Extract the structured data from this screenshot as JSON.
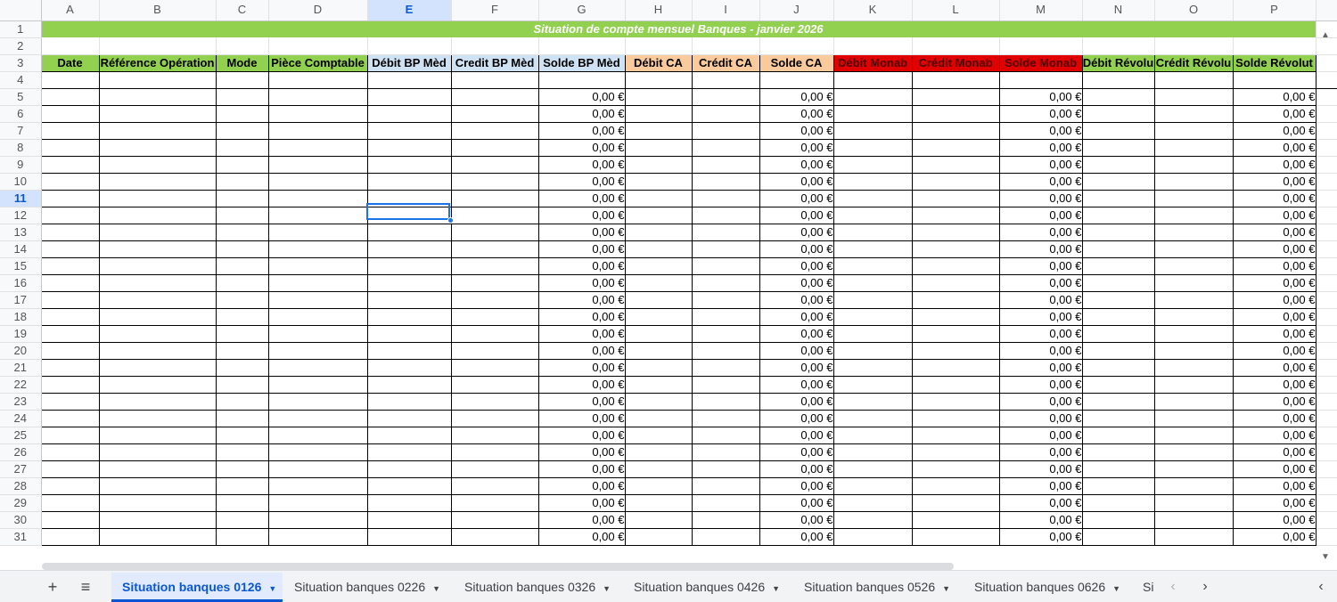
{
  "columns": [
    "A",
    "B",
    "C",
    "D",
    "E",
    "F",
    "G",
    "H",
    "I",
    "J",
    "K",
    "L",
    "M",
    "N",
    "O",
    "P"
  ],
  "selected_column": "E",
  "selected_row": 11,
  "title": "Situation de compte mensuel Banques - janvier 2026",
  "headers": [
    {
      "label": "Date",
      "bg": "#92d050",
      "color": "#000000"
    },
    {
      "label": "Référence Opération",
      "bg": "#92d050",
      "color": "#000000"
    },
    {
      "label": "Mode",
      "bg": "#92d050",
      "color": "#000000"
    },
    {
      "label": "Pièce Comptable",
      "bg": "#92d050",
      "color": "#000000"
    },
    {
      "label": "Débit BP Mèd",
      "bg": "#cfe2f3",
      "color": "#000000"
    },
    {
      "label": "Credit BP Mèd",
      "bg": "#cfe2f3",
      "color": "#000000"
    },
    {
      "label": "Solde BP Mèd",
      "bg": "#cfe2f3",
      "color": "#000000"
    },
    {
      "label": "Débit CA",
      "bg": "#f9cb9c",
      "color": "#000000"
    },
    {
      "label": "Crédit CA",
      "bg": "#f9cb9c",
      "color": "#000000"
    },
    {
      "label": "Solde CA",
      "bg": "#f9cb9c",
      "color": "#000000"
    },
    {
      "label": "Débit Monab",
      "bg": "#e00000",
      "color": "#4a0000"
    },
    {
      "label": "Crédit Monab",
      "bg": "#e00000",
      "color": "#4a0000"
    },
    {
      "label": "Solde Monab",
      "bg": "#e00000",
      "color": "#4a0000"
    },
    {
      "label": "Débit Révolu",
      "bg": "#92d050",
      "color": "#000000"
    },
    {
      "label": "Crédit Révolu",
      "bg": "#92d050",
      "color": "#000000"
    },
    {
      "label": "Solde Révolut",
      "bg": "#92d050",
      "color": "#000000"
    }
  ],
  "zero_value": "0,00 €",
  "value_columns": [
    6,
    9,
    12,
    15
  ],
  "first_data_row": 5,
  "last_row": 31,
  "tabs": [
    {
      "label": "Situation banques 0126",
      "active": true
    },
    {
      "label": "Situation banques 0226",
      "active": false
    },
    {
      "label": "Situation banques 0326",
      "active": false
    },
    {
      "label": "Situation banques 0426",
      "active": false
    },
    {
      "label": "Situation banques 0526",
      "active": false
    },
    {
      "label": "Situation banques 0626",
      "active": false
    },
    {
      "label": "Si",
      "active": false
    }
  ],
  "icons": {
    "add_sheet": "plus-icon",
    "all_sheets": "menu-icon",
    "prev": "chevron-left-icon",
    "next": "chevron-right-icon",
    "explore": "chevron-left-icon"
  }
}
